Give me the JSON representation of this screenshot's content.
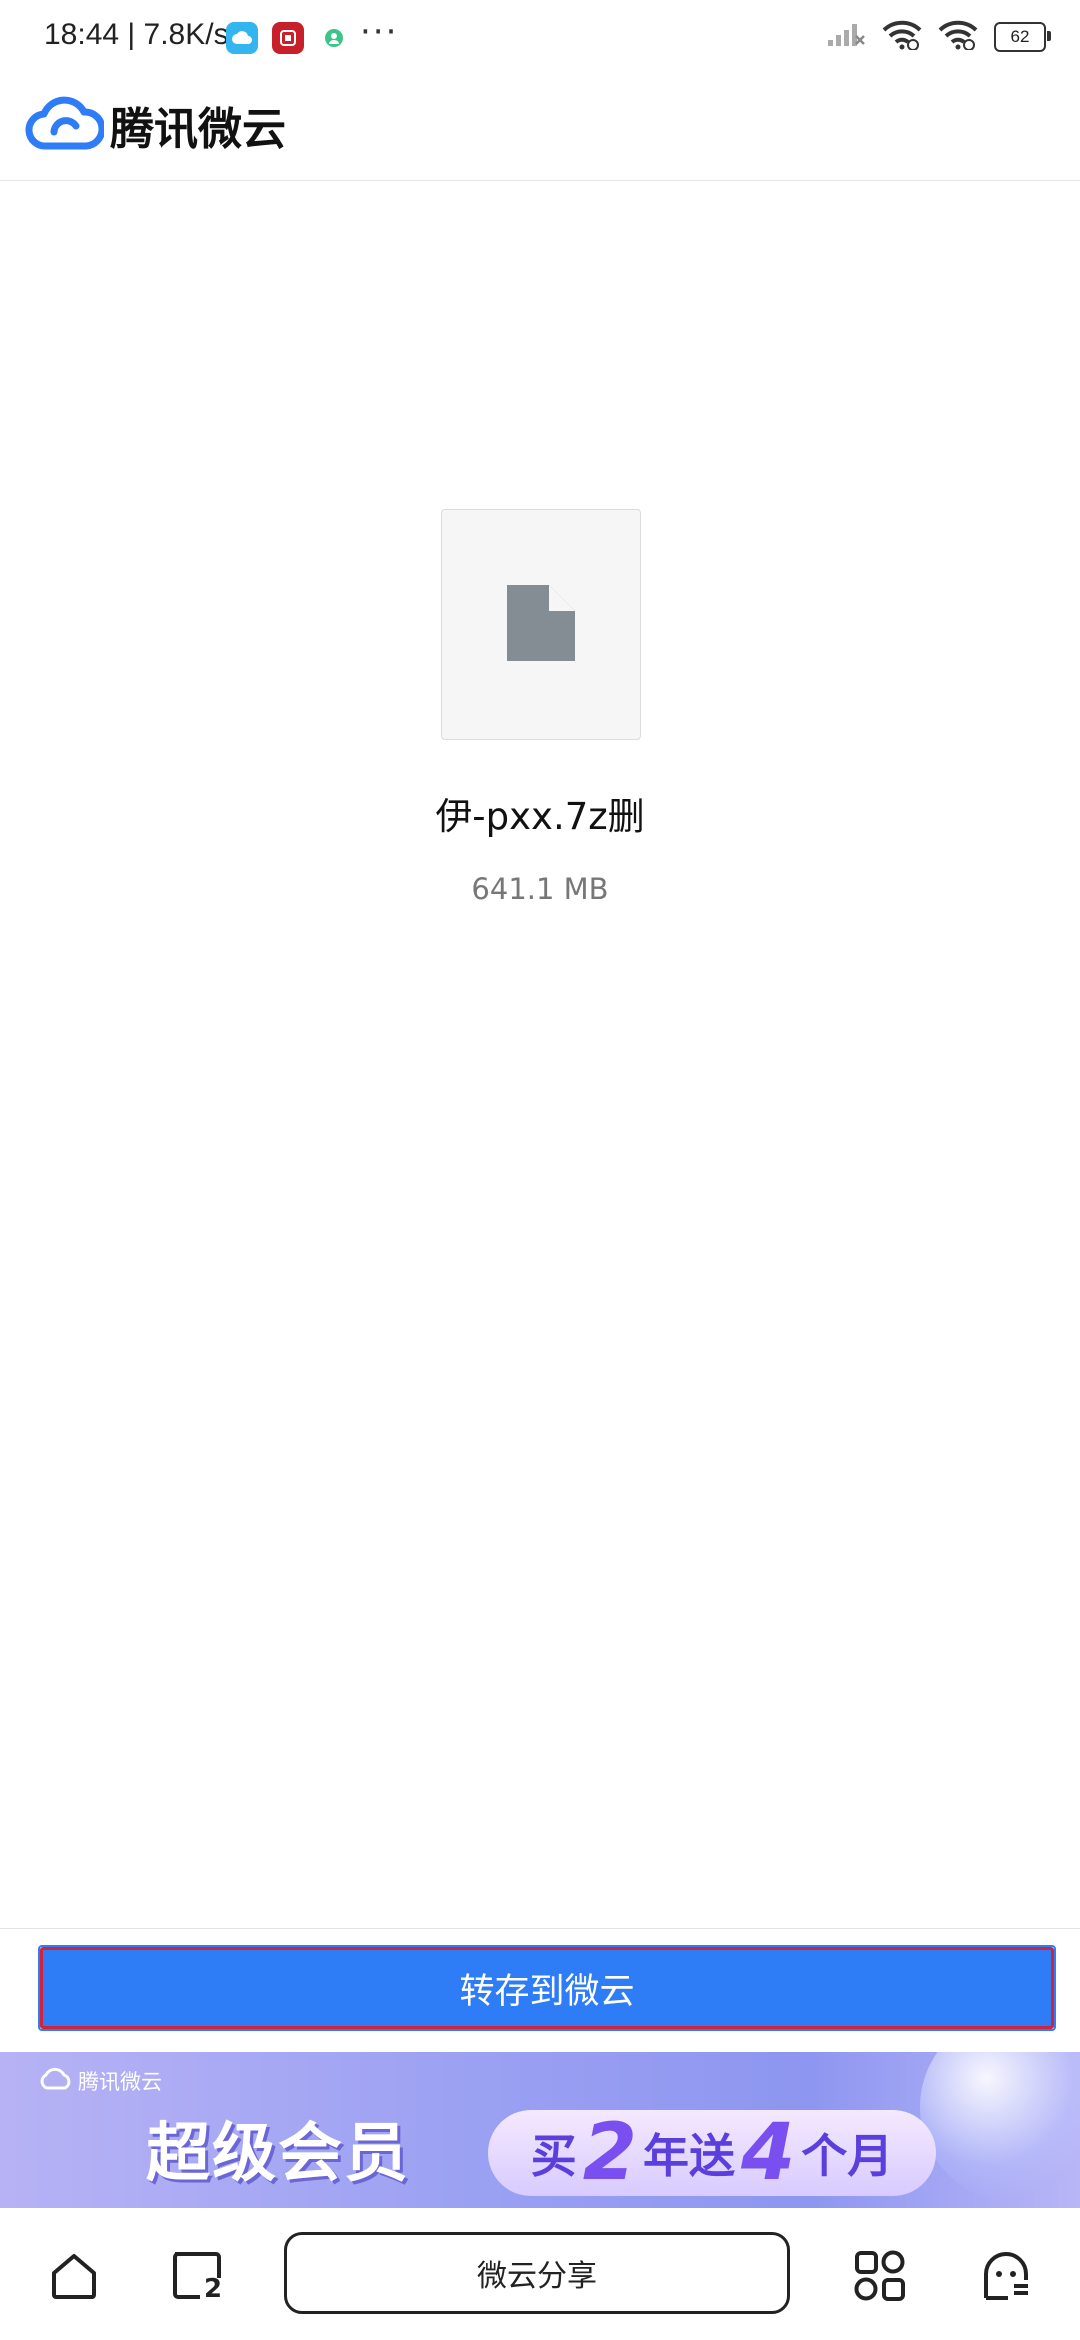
{
  "status_bar": {
    "time": "18:44 | 7.8K/s",
    "more": "···",
    "battery": "62"
  },
  "app": {
    "title": "腾讯微云"
  },
  "file": {
    "name": "伊-pxx.7z删",
    "size": "641.1 MB"
  },
  "actions": {
    "save_label": "转存到微云"
  },
  "banner": {
    "brand": "腾讯微云",
    "title": "超级会员",
    "promo_buy": "买",
    "promo_years": "2",
    "promo_nian_song": "年送",
    "promo_months": "4",
    "promo_unit": "个月"
  },
  "bottom_nav": {
    "tab_count": "2",
    "share_label": "微云分享"
  },
  "colors": {
    "accent": "#2e7cf6",
    "highlight_border": "#d1233b"
  }
}
